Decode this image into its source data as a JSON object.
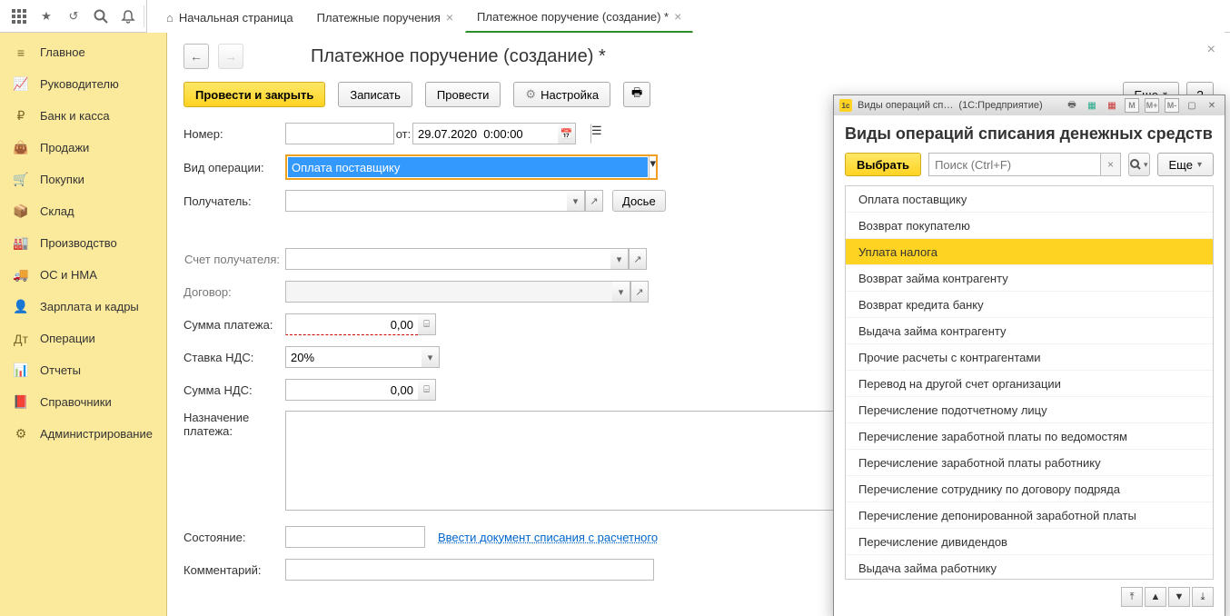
{
  "tabs": [
    {
      "label": "Начальная страница"
    },
    {
      "label": "Платежные поручения"
    },
    {
      "label": "Платежное поручение (создание) *"
    }
  ],
  "sidebar": [
    {
      "icon": "menu",
      "label": "Главное"
    },
    {
      "icon": "chart",
      "label": "Руководителю"
    },
    {
      "icon": "ruble",
      "label": "Банк и касса"
    },
    {
      "icon": "bag",
      "label": "Продажи"
    },
    {
      "icon": "cart",
      "label": "Покупки"
    },
    {
      "icon": "box",
      "label": "Склад"
    },
    {
      "icon": "factory",
      "label": "Производство"
    },
    {
      "icon": "truck",
      "label": "ОС и НМА"
    },
    {
      "icon": "people",
      "label": "Зарплата и кадры"
    },
    {
      "icon": "ops",
      "label": "Операции"
    },
    {
      "icon": "bars",
      "label": "Отчеты"
    },
    {
      "icon": "book",
      "label": "Справочники"
    },
    {
      "icon": "gear",
      "label": "Администрирование"
    }
  ],
  "page_title": "Платежное поручение (создание) *",
  "toolbar": {
    "post_close": "Провести и закрыть",
    "save": "Записать",
    "post": "Провести",
    "settings": "Настройка",
    "more": "Еще",
    "help": "?"
  },
  "form": {
    "number_label": "Номер:",
    "from_label": "от:",
    "date_value": "29.07.2020  0:00:00",
    "op_type_label": "Вид операции:",
    "op_type_value": "Оплата поставщику",
    "recipient_label": "Получатель:",
    "dossier_btn": "Досье",
    "recip_acct_label": "Счет получателя:",
    "contract_label": "Договор:",
    "amount_label": "Сумма платежа:",
    "amount_value": "0,00",
    "vat_rate_label": "Ставка НДС:",
    "vat_rate_value": "20%",
    "vat_sum_label": "Сумма НДС:",
    "vat_sum_value": "0,00",
    "purpose_label1": "Назначение",
    "purpose_label2": "платежа:",
    "state_label": "Состояние:",
    "enter_doc_link": "Ввести документ списания с расчетного",
    "comment_label": "Комментарий:"
  },
  "popup": {
    "title_short": "Виды операций сп…",
    "title_app": "(1С:Предприятие)",
    "heading": "Виды операций списания денежных средств",
    "select_btn": "Выбрать",
    "search_ph": "Поиск (Ctrl+F)",
    "more": "Еще",
    "items": [
      {
        "label": "Оплата поставщику",
        "hl": false
      },
      {
        "label": "Возврат покупателю",
        "hl": false
      },
      {
        "label": "Уплата налога",
        "hl": true
      },
      {
        "label": "Возврат займа контрагенту",
        "hl": false
      },
      {
        "label": "Возврат кредита банку",
        "hl": false
      },
      {
        "label": "Выдача займа контрагенту",
        "hl": false
      },
      {
        "label": "Прочие расчеты с контрагентами",
        "hl": false
      },
      {
        "label": "Перевод на другой счет организации",
        "hl": false
      },
      {
        "label": "Перечисление подотчетному лицу",
        "hl": false
      },
      {
        "label": "Перечисление заработной платы по ведомостям",
        "hl": false
      },
      {
        "label": "Перечисление заработной платы работнику",
        "hl": false
      },
      {
        "label": "Перечисление сотруднику по договору подряда",
        "hl": false
      },
      {
        "label": "Перечисление депонированной заработной платы",
        "hl": false
      },
      {
        "label": "Перечисление дивидендов",
        "hl": false
      },
      {
        "label": "Выдача займа работнику",
        "hl": false
      }
    ]
  },
  "colors": {
    "accent": "#ffd321"
  }
}
